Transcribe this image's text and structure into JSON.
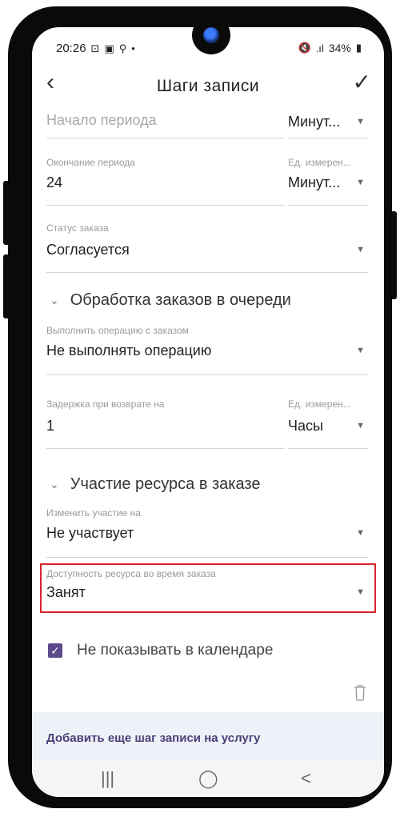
{
  "status_bar": {
    "time": "20:26",
    "left_icons": [
      "screenshot-icon",
      "gallery-icon",
      "search-icon",
      "dot-icon"
    ],
    "right_text": "34%",
    "right_icons": [
      "mute-icon",
      "4g-signal-icon",
      "battery-icon"
    ]
  },
  "app_bar": {
    "title": "Шаги записи",
    "back_icon": "chevron-left-icon",
    "confirm_icon": "check-icon"
  },
  "fields": {
    "period_start": {
      "placeholder": "Начало периода",
      "unit_value": "Минут..."
    },
    "period_end": {
      "label": "Окончание периода",
      "value": "24",
      "unit_label": "Ед. измерен...",
      "unit_value": "Минут..."
    },
    "order_status": {
      "label": "Статус заказа",
      "value": "Согласуется"
    },
    "queue_operation": {
      "label": "Выполнить операцию с заказом",
      "value": "Не выполнять операцию"
    },
    "return_delay": {
      "label": "Задержка при возврате на",
      "value": "1",
      "unit_label": "Ед. измерен...",
      "unit_value": "Часы"
    },
    "participation": {
      "label": "Изменить участие на",
      "value": "Не участвует"
    },
    "availability": {
      "label": "Доступность ресурса во время заказа",
      "value": "Занят"
    }
  },
  "sections": {
    "queue": "Обработка заказов в очереди",
    "resource": "Участие ресурса в заказе"
  },
  "checkbox": {
    "label": "Не показывать в календаре",
    "checked": true
  },
  "add_step": "Добавить еще шаг записи на услугу",
  "nav": {
    "recent": "|||",
    "home": "◯",
    "back": "<"
  },
  "colors": {
    "accent": "#5c4a8c",
    "highlight": "#d8232f",
    "add_bar_bg": "#eef2f8"
  }
}
